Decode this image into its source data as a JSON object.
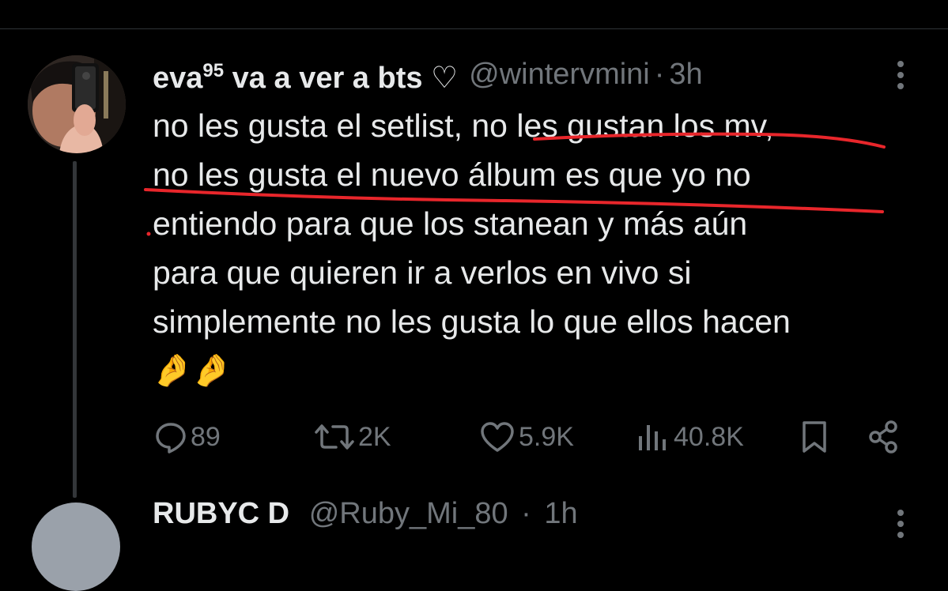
{
  "tweet": {
    "author": {
      "name": "eva",
      "name_sup": "95",
      "name_rest": "va a ver a bts ♡",
      "handle": "@wintervmini",
      "separator": "·",
      "time": "3h"
    },
    "text_lines": [
      "no les gusta el setlist, no les gustan los mv,",
      "no les gusta el nuevo álbum es que yo no",
      "entiendo para que los stanean y más aún",
      "para que quieren ir a verlos en vivo si",
      "simplemente no les gusta lo que ellos hacen"
    ],
    "emoji": "🤌🤌",
    "stats": {
      "replies": "89",
      "reposts": "2K",
      "likes": "5.9K",
      "views": "40.8K"
    }
  },
  "next_tweet": {
    "name": "RUBYC D",
    "handle": "@Ruby_Mi_80",
    "time": "1h"
  },
  "icons": {
    "more": "more-vertical-icon",
    "reply": "reply-bubble-icon",
    "repost": "repost-arrows-icon",
    "like": "heart-icon",
    "views": "bar-chart-icon",
    "bookmark": "bookmark-icon",
    "share": "share-nodes-icon"
  },
  "colors": {
    "background": "#000000",
    "text_primary": "#e7e9ea",
    "text_secondary": "#71767b",
    "divider": "#2f3336",
    "annotation_red": "#e8262b"
  }
}
